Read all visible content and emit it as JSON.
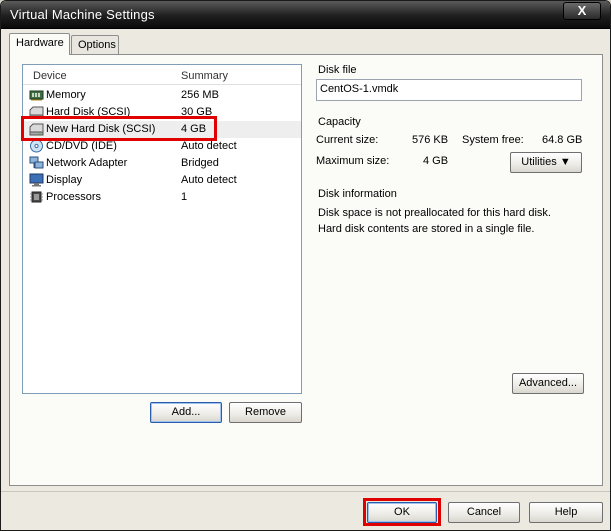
{
  "window": {
    "title": "Virtual Machine Settings",
    "close": "X"
  },
  "tabs": [
    {
      "label": "Hardware",
      "active": true
    },
    {
      "label": "Options",
      "active": false
    }
  ],
  "device_list": {
    "columns": [
      "Device",
      "Summary"
    ],
    "devices": [
      {
        "name": "Memory",
        "summary": "256 MB",
        "icon": "memory-icon"
      },
      {
        "name": "Hard Disk (SCSI)",
        "summary": "30 GB",
        "icon": "hard-disk-icon"
      },
      {
        "name": "New Hard Disk (SCSI)",
        "summary": "4 GB",
        "icon": "hard-disk-icon",
        "selected": true
      },
      {
        "name": "CD/DVD (IDE)",
        "summary": "Auto detect",
        "icon": "cd-dvd-icon"
      },
      {
        "name": "Network Adapter",
        "summary": "Bridged",
        "icon": "network-adapter-icon"
      },
      {
        "name": "Display",
        "summary": "Auto detect",
        "icon": "display-icon"
      },
      {
        "name": "Processors",
        "summary": "1",
        "icon": "processor-icon"
      }
    ]
  },
  "buttons": {
    "add": "Add...",
    "remove": "Remove",
    "ok": "OK",
    "cancel": "Cancel",
    "help": "Help",
    "utilities": "Utilities",
    "advanced": "Advanced..."
  },
  "disk_file": {
    "label": "Disk file",
    "value": "CentOS-1.vmdk"
  },
  "capacity": {
    "label": "Capacity",
    "current_size_label": "Current size:",
    "current_size": "576 KB",
    "system_free_label": "System free:",
    "system_free": "64.8 GB",
    "maximum_size_label": "Maximum size:",
    "maximum_size": "4 GB"
  },
  "disk_information": {
    "label": "Disk information",
    "line1": "Disk space is not preallocated for this hard disk.",
    "line2": "Hard disk contents are stored in a single file."
  },
  "colors": {
    "highlight": "#e00000",
    "titlebar": "#1f1f1f"
  }
}
